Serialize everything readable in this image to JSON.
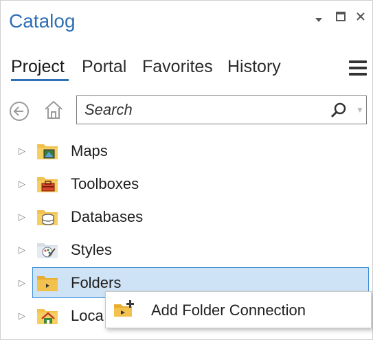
{
  "window": {
    "title": "Catalog",
    "controls": [
      "chevron-down-icon",
      "maximize-icon",
      "close-icon"
    ]
  },
  "tabs": [
    {
      "label": "Project",
      "active": true
    },
    {
      "label": "Portal",
      "active": false
    },
    {
      "label": "Favorites",
      "active": false
    },
    {
      "label": "History",
      "active": false
    }
  ],
  "nav": {
    "back_icon": "back-arrow-icon",
    "home_icon": "home-icon",
    "search": {
      "placeholder": "Search",
      "value": ""
    }
  },
  "tree": {
    "items": [
      {
        "label": "Maps",
        "icon": "maps-folder-icon",
        "selected": false
      },
      {
        "label": "Toolboxes",
        "icon": "toolbox-folder-icon",
        "selected": false
      },
      {
        "label": "Databases",
        "icon": "database-folder-icon",
        "selected": false
      },
      {
        "label": "Styles",
        "icon": "styles-folder-icon",
        "selected": false
      },
      {
        "label": "Folders",
        "icon": "folders-folder-icon",
        "selected": true
      },
      {
        "label": "Loca",
        "icon": "locators-folder-icon",
        "selected": false
      }
    ]
  },
  "context_menu": {
    "items": [
      {
        "label": "Add Folder Connection",
        "icon": "add-folder-icon"
      }
    ]
  },
  "colors": {
    "accent": "#2f6fb5",
    "selection_fill": "#cfe3f6",
    "selection_border": "#3b8ed6",
    "folder": "#f2c14e"
  }
}
